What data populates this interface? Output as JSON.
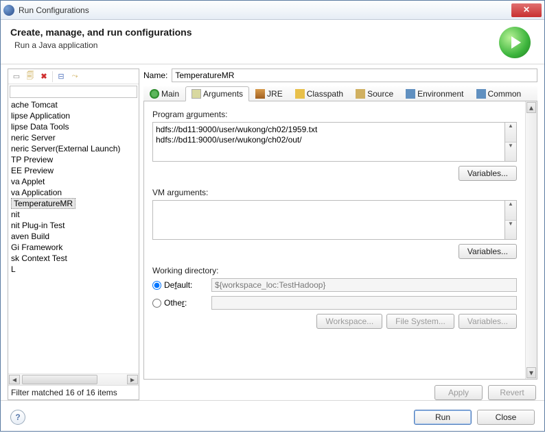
{
  "window": {
    "title": "Run Configurations"
  },
  "header": {
    "title": "Create, manage, and run configurations",
    "subtitle": "Run a Java application"
  },
  "left": {
    "items": [
      "ache Tomcat",
      "lipse Application",
      "lipse Data Tools",
      "neric Server",
      "neric Server(External Launch)",
      "TP Preview",
      "EE Preview",
      "va Applet",
      "va Application",
      "TemperatureMR",
      "nit",
      "nit Plug-in Test",
      "aven Build",
      "Gi Framework",
      "sk Context Test",
      "L"
    ],
    "selected_index": 9,
    "filter_status": "Filter matched 16 of 16 items"
  },
  "form": {
    "name_label": "Name:",
    "name_value": "TemperatureMR"
  },
  "tabs": {
    "items": [
      "Main",
      "Arguments",
      "JRE",
      "Classpath",
      "Source",
      "Environment",
      "Common"
    ],
    "active_index": 1
  },
  "args": {
    "program_label_pre": "Program ",
    "program_label_hot": "a",
    "program_label_post": "rguments:",
    "program_value": "hdfs://bd11:9000/user/wukong/ch02/1959.txt\nhdfs://bd11:9000/user/wukong/ch02/out/",
    "vm_label": "VM arguments:",
    "vm_value": "",
    "variables_btn": "Variables...",
    "wd_label": "Working directory:",
    "default_label": "Default:",
    "default_value": "${workspace_loc:TestHadoop}",
    "other_label": "Other:",
    "workspace_btn": "Workspace...",
    "filesystem_btn": "File System...",
    "variables2_btn": "Variables..."
  },
  "actions": {
    "apply": "Apply",
    "revert": "Revert",
    "run": "Run",
    "close": "Close"
  }
}
